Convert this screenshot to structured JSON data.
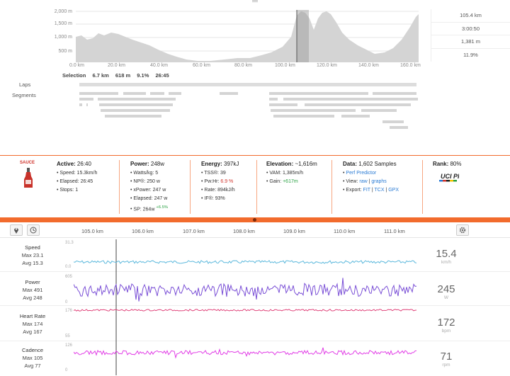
{
  "elevation": {
    "y_ticks": [
      "2,000 m",
      "1,500 m",
      "1,000 m",
      "500 m"
    ],
    "x_ticks": [
      "0.0 km",
      "20.0 km",
      "40.0 km",
      "60.0 km",
      "80.0 km",
      "100.0 km",
      "120.0 km",
      "140.0 km",
      "160.0 km"
    ],
    "summary": [
      "105.4 km",
      "3:00:50",
      "1,381 m",
      "11.9%"
    ],
    "selection": {
      "label": "Selection",
      "distance": "6.7 km",
      "gain": "618 m",
      "grade": "9.1%",
      "time": "26:45"
    }
  },
  "rows_labels": {
    "laps": "Laps",
    "segments": "Segments"
  },
  "info": {
    "logo_text": "SAUCE",
    "active": {
      "title": "Active:",
      "value": "26:40",
      "items": [
        {
          "k": "Speed: ",
          "v": "15.3",
          "u": "km/h"
        },
        {
          "k": "Elapsed: ",
          "v": "26:45",
          "u": ""
        },
        {
          "k": "Stops: ",
          "v": "1",
          "u": ""
        }
      ]
    },
    "power": {
      "title": "Power:",
      "value": "248",
      "unit": "w",
      "items": [
        {
          "k": "Watts/kg: ",
          "v": "5"
        },
        {
          "k": "NP®: ",
          "v": "250",
          "u": "w"
        },
        {
          "k": "xPower: ",
          "v": "247",
          "u": "w"
        },
        {
          "k": "Elapsed: ",
          "v": "247",
          "u": "w"
        },
        {
          "k": "SP: ",
          "v": "264",
          "u": "w",
          "sup": "+6.5%"
        }
      ]
    },
    "energy": {
      "title": "Energy:",
      "value": "397",
      "unit": "kJ",
      "items": [
        {
          "k": "TSS®: ",
          "v": "39"
        },
        {
          "k": "Pw:Hr: ",
          "v": "6.9 %",
          "cls": "red"
        },
        {
          "k": "Rate: ",
          "v": "894",
          "u": "kJ/h"
        },
        {
          "k": "IF®: ",
          "v": "93%"
        }
      ]
    },
    "elevation": {
      "title": "Elevation:",
      "value": "~1,616",
      "unit": "m",
      "items": [
        {
          "k": "VAM: ",
          "v": "1,385",
          "u": "m/h"
        },
        {
          "k": "Gain: ",
          "v": "+617",
          "u": "m",
          "cls": "green"
        }
      ]
    },
    "data": {
      "title": "Data:",
      "value": "1,602 Samples",
      "perf": "Perf Predictor",
      "view_label": "View:",
      "view_raw": "raw",
      "view_graphs": "graphs",
      "export_label": "Export:",
      "export_fit": "FIT",
      "export_tcx": "TCX",
      "export_gpx": "GPX"
    },
    "rank": {
      "title": "Rank:",
      "value": "80%",
      "badge": "UCI PRO"
    }
  },
  "toolbar": {
    "x_ticks": [
      "105.0 km",
      "106.0 km",
      "107.0 km",
      "108.0 km",
      "109.0 km",
      "110.0 km",
      "111.0 km"
    ]
  },
  "streams": [
    {
      "name": "Speed",
      "max": "Max 23.1",
      "avg": "Avg 15.3",
      "top": "31.3",
      "bottom": "0.0",
      "value": "15.4",
      "unit": "km/h",
      "color": "#5bb8dc"
    },
    {
      "name": "Power",
      "max": "Max 491",
      "avg": "Avg 248",
      "top": "605",
      "bottom": "0",
      "value": "245",
      "unit": "W",
      "color": "#7a4fd6"
    },
    {
      "name": "Heart Rate",
      "max": "Max 174",
      "avg": "Avg 167",
      "top": "176",
      "bottom": "55",
      "value": "172",
      "unit": "bpm",
      "color": "#e0457b"
    },
    {
      "name": "Cadence",
      "max": "Max 105",
      "avg": "Avg 77",
      "top": "126",
      "bottom": "0",
      "value": "71",
      "unit": "rpm",
      "color": "#e13de6"
    }
  ]
}
